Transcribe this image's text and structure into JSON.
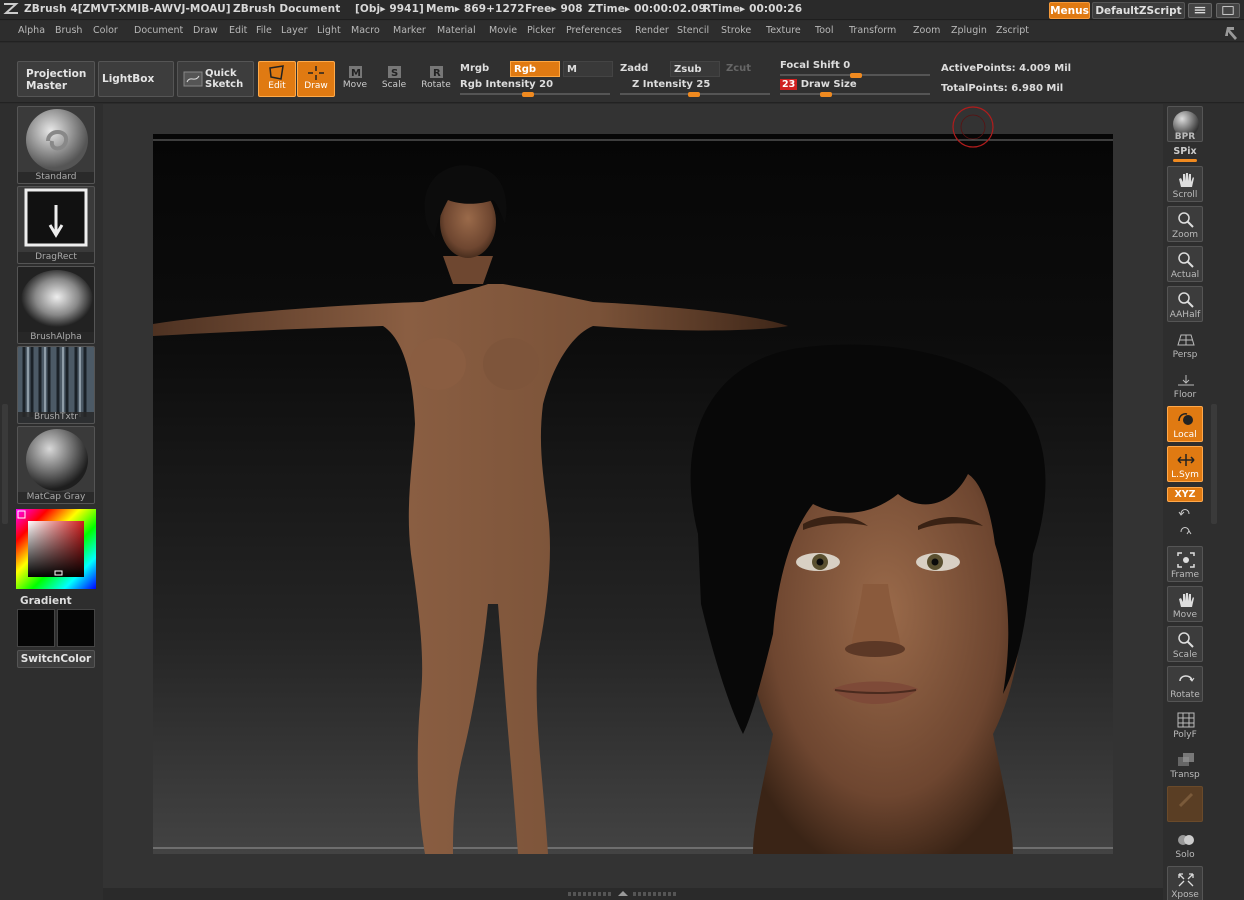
{
  "title_bar": {
    "app": "ZBrush 4[ZMVT-XMIB-AWVJ-MOAU]",
    "document": "ZBrush Document",
    "obj": "[Obj▸ 9941]",
    "mem": "Mem▸ 869+1272",
    "free": "Free▸ 908",
    "ztime": "ZTime▸ 00:00:02.09",
    "rtime": "RTime▸ 00:00:26",
    "menus_button": "Menus",
    "script_button": "DefaultZScript"
  },
  "menu_bar": [
    "Alpha",
    "Brush",
    "Color",
    "Document",
    "Draw",
    "Edit",
    "File",
    "Layer",
    "Light",
    "Macro",
    "Marker",
    "Material",
    "Movie",
    "Picker",
    "Preferences",
    "Render",
    "Stencil",
    "Stroke",
    "Texture",
    "Tool",
    "Transform",
    "Zoom",
    "Zplugin",
    "Zscript"
  ],
  "toolbar": {
    "projection_master_line1": "Projection",
    "projection_master_line2": "Master",
    "lightbox": "LightBox",
    "quick_sketch_line1": "Quick",
    "quick_sketch_line2": "Sketch",
    "edit": "Edit",
    "draw": "Draw",
    "move": "Move",
    "scale": "Scale",
    "rotate": "Rotate",
    "mrgb": "Mrgb",
    "rgb": "Rgb",
    "m": "M",
    "rgb_intensity": "Rgb Intensity 20",
    "rgb_intensity_value": 20,
    "zadd": "Zadd",
    "zsub": "Zsub",
    "zcut": "Zcut",
    "z_intensity": "Z Intensity 25",
    "z_intensity_value": 25,
    "focal_shift": "Focal Shift 0",
    "focal_shift_value": 0,
    "draw_size_badge": "23",
    "draw_size": "Draw Size",
    "draw_size_value": 23,
    "active_points": "ActivePoints: 4.009 Mil",
    "total_points": "TotalPoints: 6.980 Mil"
  },
  "left_shelf": {
    "brush": "Standard",
    "stroke": "DragRect",
    "alpha": "BrushAlpha",
    "texture": "BrushTxtr",
    "material": "MatCap Gray",
    "gradient": "Gradient",
    "switch_color": "SwitchColor"
  },
  "right_shelf": {
    "bpr": "BPR",
    "spix": "SPix",
    "scroll": "Scroll",
    "zoom": "Zoom",
    "actual": "Actual",
    "aahalf": "AAHalf",
    "persp": "Persp",
    "floor": "Floor",
    "local": "Local",
    "lsym": "L.Sym",
    "xyz": "XYZ",
    "frame": "Frame",
    "move": "Move",
    "scale": "Scale",
    "rotate": "Rotate",
    "polyf": "PolyF",
    "transp": "Transp",
    "solo": "Solo",
    "xpose": "Xpose"
  },
  "colors": {
    "accent": "#e07a12",
    "skin": "#7a5238",
    "hair": "#0a0a0a"
  }
}
